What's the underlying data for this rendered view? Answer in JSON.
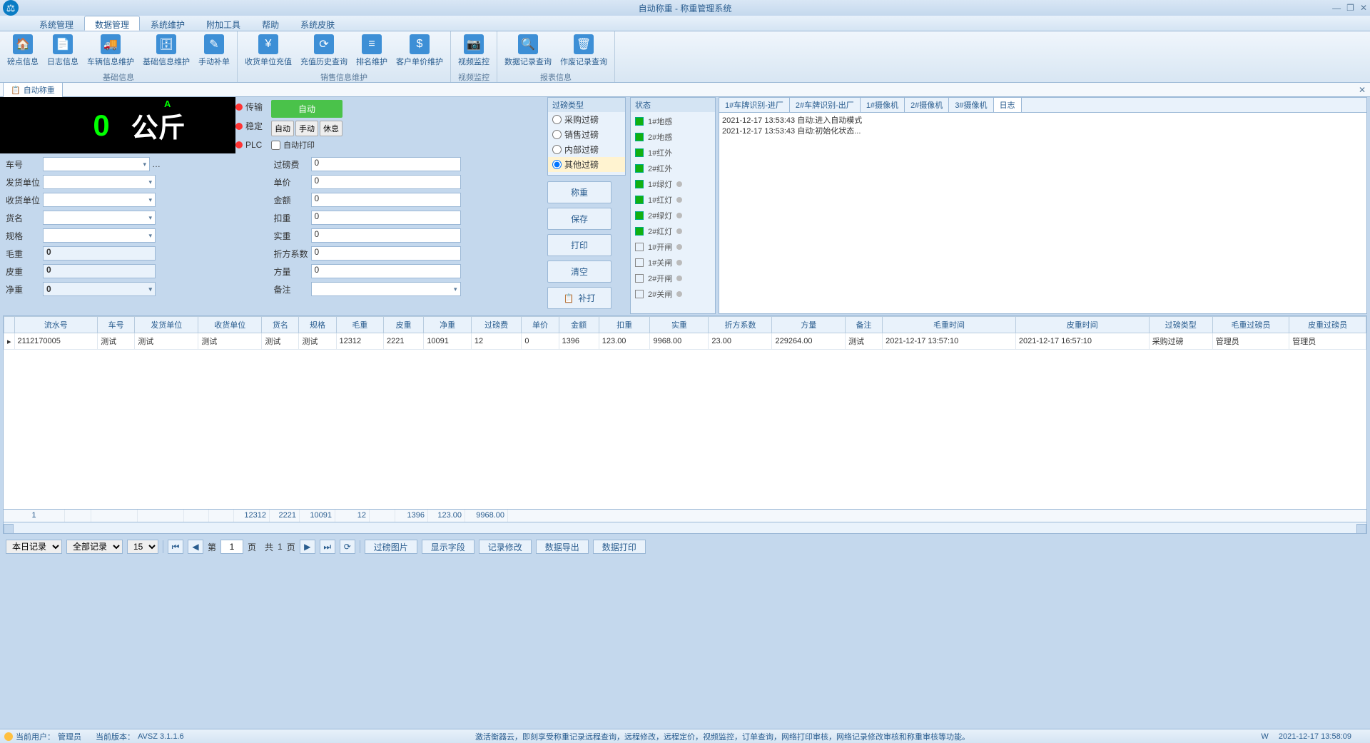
{
  "window": {
    "title": "自动称重 - 称重管理系统"
  },
  "menu": {
    "tabs": [
      "系统管理",
      "数据管理",
      "系统维护",
      "附加工具",
      "帮助",
      "系统皮肤"
    ],
    "active": 1
  },
  "ribbon": {
    "groups": [
      {
        "label": "基础信息",
        "items": [
          "磅点信息",
          "日志信息",
          "车辆信息维护",
          "基础信息维护",
          "手动补单"
        ]
      },
      {
        "label": "销售信息维护",
        "items": [
          "收货单位充值",
          "充值历史查询",
          "排名维护",
          "客户单价维护"
        ]
      },
      {
        "label": "视频监控",
        "items": [
          "视频监控"
        ]
      },
      {
        "label": "报表信息",
        "items": [
          "数据记录查询",
          "作废记录查询"
        ]
      }
    ]
  },
  "subtab": {
    "label": "自动称重"
  },
  "weight": {
    "value": "0",
    "unit": "公斤",
    "marker": "A"
  },
  "indicators": [
    "传输",
    "稳定",
    "PLC"
  ],
  "mode": {
    "auto": "自动",
    "manual": "手动",
    "rest": "休息",
    "auto_btn": "自动",
    "autoprint": "自动打印"
  },
  "weigh_type": {
    "header": "过磅类型",
    "options": [
      "采购过磅",
      "销售过磅",
      "内部过磅",
      "其他过磅"
    ],
    "selected": 3
  },
  "status": {
    "header": "状态",
    "items": [
      "1#地感",
      "2#地感",
      "1#红外",
      "2#红外",
      "1#绿灯",
      "1#红灯",
      "2#绿灯",
      "2#红灯",
      "1#开闸",
      "1#关闸",
      "2#开闸",
      "2#关闸"
    ]
  },
  "actions": {
    "weigh": "称重",
    "save": "保存",
    "print": "打印",
    "clear": "清空",
    "reprint": "补打"
  },
  "form": {
    "labels": {
      "plate": "车号",
      "fee": "过磅费",
      "shipper": "发货单位",
      "price": "单价",
      "receiver": "收货单位",
      "amount": "金额",
      "goods": "货名",
      "deduct": "扣重",
      "spec": "规格",
      "real": "实重",
      "gross": "毛重",
      "coef": "折方系数",
      "tare": "皮重",
      "volume": "方量",
      "net": "净重",
      "remark": "备注"
    },
    "values": {
      "fee": "0",
      "price": "0",
      "amount": "0",
      "deduct": "0",
      "real": "0",
      "gross": "0",
      "coef": "0",
      "tare": "0",
      "volume": "0",
      "net": "0"
    }
  },
  "log_tabs": [
    "1#车牌识别-进厂",
    "2#车牌识别-出厂",
    "1#摄像机",
    "2#摄像机",
    "3#摄像机",
    "日志"
  ],
  "log_active": 5,
  "log_lines": [
    "2021-12-17 13:53:43 自动:进入自动模式",
    "2021-12-17 13:53:43 自动:初始化状态..."
  ],
  "grid": {
    "headers": [
      "流水号",
      "车号",
      "发货单位",
      "收货单位",
      "货名",
      "规格",
      "毛重",
      "皮重",
      "净重",
      "过磅费",
      "单价",
      "金额",
      "扣重",
      "实重",
      "折方系数",
      "方量",
      "备注",
      "毛重时间",
      "皮重时间",
      "过磅类型",
      "毛重过磅员",
      "皮重过磅员"
    ],
    "rows": [
      [
        "2112170005",
        "测试",
        "测试",
        "测试",
        "测试",
        "测试",
        "12312",
        "2221",
        "10091",
        "12",
        "0",
        "1396",
        "123.00",
        "9968.00",
        "23.00",
        "229264.00",
        "测试",
        "2021-12-17 13:57:10",
        "2021-12-17 16:57:10",
        "采购过磅",
        "管理员",
        "管理员"
      ]
    ],
    "sums": {
      "count": "1",
      "gross": "12312",
      "tare": "2221",
      "net": "10091",
      "fee": "12",
      "amount": "1396",
      "deduct": "123.00",
      "real": "9968.00"
    }
  },
  "pager": {
    "filter1": "本日记录",
    "filter2": "全部记录",
    "pagesize": "15",
    "page": "1",
    "page_prefix": "第",
    "page_mid": "页　共",
    "total_pages": "1",
    "page_suffix": "页",
    "btns": {
      "img": "过磅图片",
      "fields": "显示字段",
      "edit": "记录修改",
      "export": "数据导出",
      "print": "数据打印"
    }
  },
  "statusbar": {
    "user_label": "当前用户：",
    "user": "管理员",
    "ver_label": "当前版本：",
    "ver": "AVSZ 3.1.1.6",
    "msg": "激活衡器云，即刻享受称重记录远程查询，远程修改，远程定价，视频监控，订单查询，网络打印审核，网络记录修改审核和称重审核等功能。",
    "w": "W",
    "time": "2021-12-17 13:58:09"
  }
}
